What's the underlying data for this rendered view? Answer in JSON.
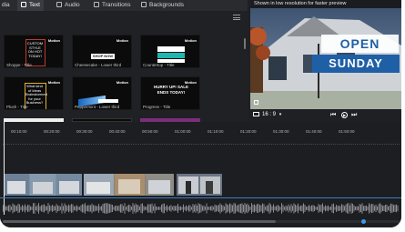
{
  "tabs": {
    "partial": "dia",
    "text": "Text",
    "audio": "Audio",
    "transitions": "Transitions",
    "backgrounds": "Backgrounds"
  },
  "templates": [
    {
      "label": "Shoppe - Title",
      "badge": "Motion",
      "caption": "CUSTOM STYLE ON HOT TODAY!"
    },
    {
      "label": "Cheesecake - Lower third",
      "badge": "Motion",
      "caption": "SHOP NOW"
    },
    {
      "label": "Countertop - Title",
      "badge": "Motion",
      "caption": ""
    },
    {
      "label": "Plush - Title",
      "badge": "Motion",
      "caption": "What kind of Ideas Brainstormed for your Business?"
    },
    {
      "label": "Peppermint - Lower third",
      "badge": "Motion",
      "caption": ""
    },
    {
      "label": "Progress - Title",
      "badge": "Motion",
      "caption": "HURRY UP! SALE ENDS TODAY!"
    }
  ],
  "preview": {
    "note": "Shown in low resolution for faster preview",
    "sign_line1": "OPEN",
    "sign_line2": "SUNDAY",
    "ratio": "16 : 9",
    "chevron": "▾"
  },
  "timeline": {
    "ticks": [
      "00:10:00",
      "00:20:00",
      "00:30:00",
      "00:40:00",
      "00:50:00",
      "01:00:00",
      "01:10:00",
      "01:20:00",
      "01:30:00",
      "01:40:00",
      "01:50:00"
    ]
  },
  "colors": {
    "accent": "#3a9cf0",
    "sign_blue": "#1f5fa5"
  }
}
